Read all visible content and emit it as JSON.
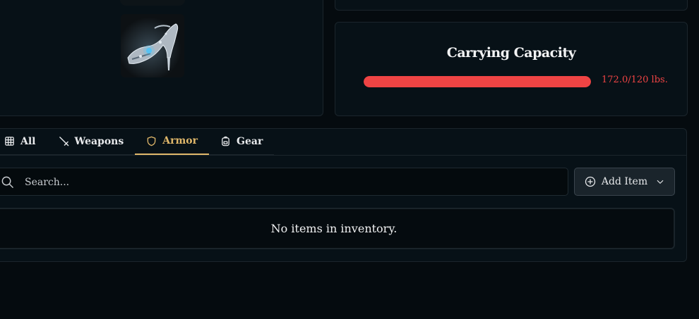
{
  "carrying_capacity": {
    "title": "Carrying Capacity",
    "label": "172.0/120 lbs.",
    "fill_fraction": 1.0,
    "color": "#ef4444"
  },
  "inventory": {
    "tabs": [
      {
        "label": "All",
        "icon": "grid-icon",
        "active": false
      },
      {
        "label": "Weapons",
        "icon": "sword-icon",
        "active": false
      },
      {
        "label": "Armor",
        "icon": "shield-icon",
        "active": true
      },
      {
        "label": "Gear",
        "icon": "backpack-icon",
        "active": false
      }
    ],
    "search": {
      "placeholder": "Search...",
      "icon": "search-icon"
    },
    "add_item": {
      "label": "Add Item",
      "icon": "plus-circle-icon"
    },
    "empty_message": "No items in inventory."
  },
  "colors": {
    "accent": "#e0b76a",
    "danger": "#ef4444",
    "background": "#050b0f"
  }
}
